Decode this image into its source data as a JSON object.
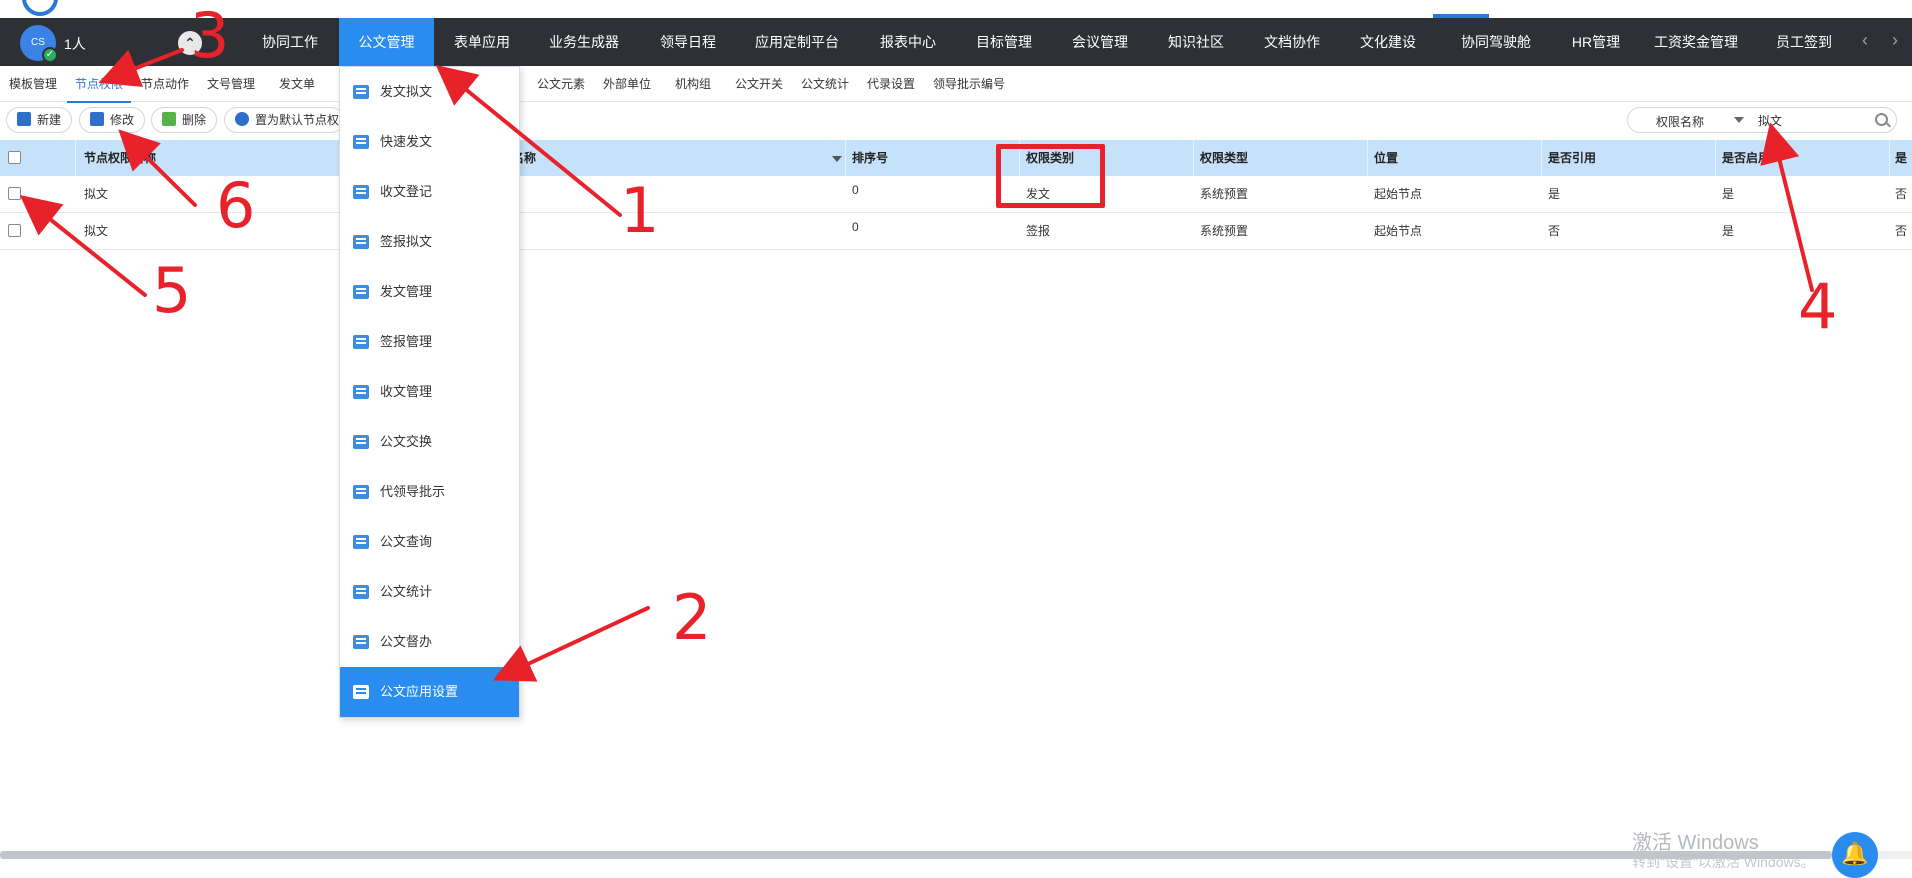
{
  "user": {
    "avatar_text": "CS",
    "online_count": "1人"
  },
  "nav": {
    "items": [
      "协同工作",
      "公文管理",
      "表单应用",
      "业务生成器",
      "领导日程",
      "应用定制平台",
      "报表中心",
      "目标管理",
      "会议管理",
      "知识社区",
      "文档协作",
      "文化建设",
      "协同驾驶舱",
      "HR管理",
      "工资奖金管理",
      "员工签到"
    ],
    "active": "公文管理",
    "prev_icon": "‹",
    "next_icon": "›"
  },
  "subtabs": {
    "items": [
      "模板管理",
      "节点权限",
      "节点动作",
      "文号管理",
      "发文单",
      "公文元素",
      "外部单位",
      "机构组",
      "公文开关",
      "公文统计",
      "代录设置",
      "领导批示编号"
    ],
    "active": "节点权限"
  },
  "toolbar": {
    "new_label": "新建",
    "edit_label": "修改",
    "delete_label": "删除",
    "default_label": "置为默认节点权"
  },
  "search": {
    "field": "权限名称",
    "value": "拟文"
  },
  "table": {
    "headers": [
      "节点权限名称",
      "名称",
      "排序号",
      "权限类别",
      "权限类型",
      "位置",
      "是否引用",
      "是否启用",
      "是"
    ],
    "rows": [
      [
        "拟文",
        "0",
        "发文",
        "系统预置",
        "起始节点",
        "是",
        "是",
        "否"
      ],
      [
        "拟文",
        "0",
        "签报",
        "系统预置",
        "起始节点",
        "否",
        "是",
        "否"
      ]
    ]
  },
  "dropdown": {
    "items": [
      "发文拟文",
      "快速发文",
      "收文登记",
      "签报拟文",
      "发文管理",
      "签报管理",
      "收文管理",
      "公文交换",
      "代领导批示",
      "公文查询",
      "公文统计",
      "公文督办",
      "公文应用设置"
    ],
    "selected": "公文应用设置"
  },
  "watermark": {
    "line1": "激活 Windows",
    "line2": "转到\"设置\"以激活 Windows。"
  },
  "annotations": [
    "1",
    "2",
    "3",
    "4",
    "5",
    "6"
  ],
  "colors": {
    "navbar": "#2d3035",
    "accent": "#2b8cf0",
    "table_header": "#c5e2fa",
    "annotation": "#e8222a"
  }
}
